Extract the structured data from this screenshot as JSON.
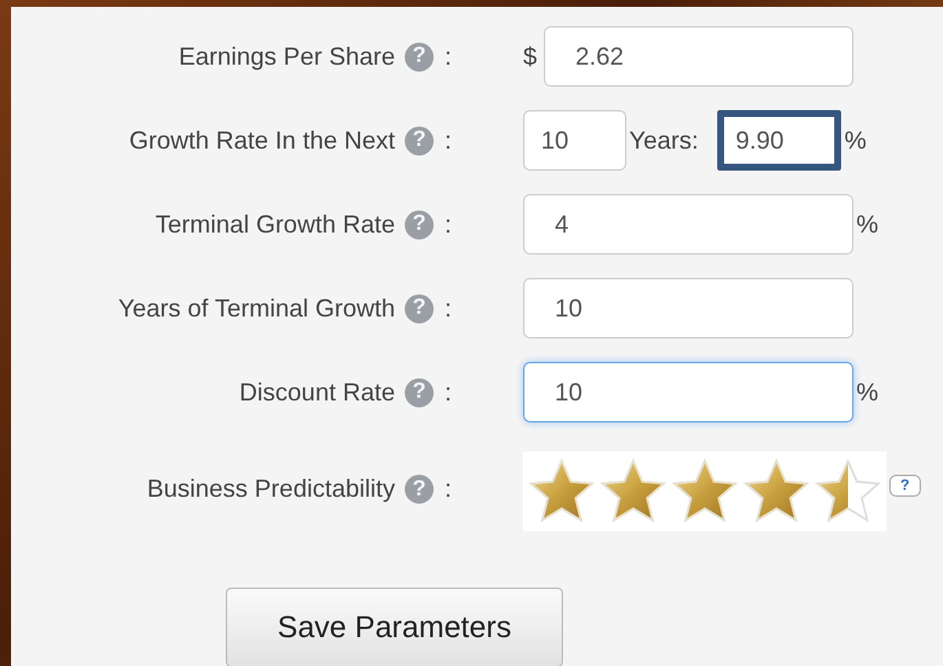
{
  "fields": [
    {
      "kind": "text",
      "label": "Earnings Per Share",
      "help": "?",
      "colon": ":",
      "prefix": "$",
      "value": "2.62",
      "focused": false
    },
    {
      "kind": "growth",
      "label": "Growth Rate In the Next",
      "help": "?",
      "colon": ":",
      "years": "10",
      "years_label": "Years:",
      "value": "9.90",
      "suffix": "%",
      "highlighted": true
    },
    {
      "kind": "text",
      "label": "Terminal Growth Rate",
      "help": "?",
      "colon": ":",
      "value": "4",
      "suffix": "%",
      "focused": false
    },
    {
      "kind": "text",
      "label": "Years of Terminal Growth",
      "help": "?",
      "colon": ":",
      "value": "10",
      "focused": false
    },
    {
      "kind": "text",
      "label": "Discount Rate",
      "help": "?",
      "colon": ":",
      "value": "10",
      "suffix": "%",
      "focused": true
    },
    {
      "kind": "stars",
      "label": "Business Predictability",
      "help": "?",
      "colon": ":",
      "stars": 4.5,
      "bubble": "?"
    }
  ],
  "save_button": "Save Parameters"
}
